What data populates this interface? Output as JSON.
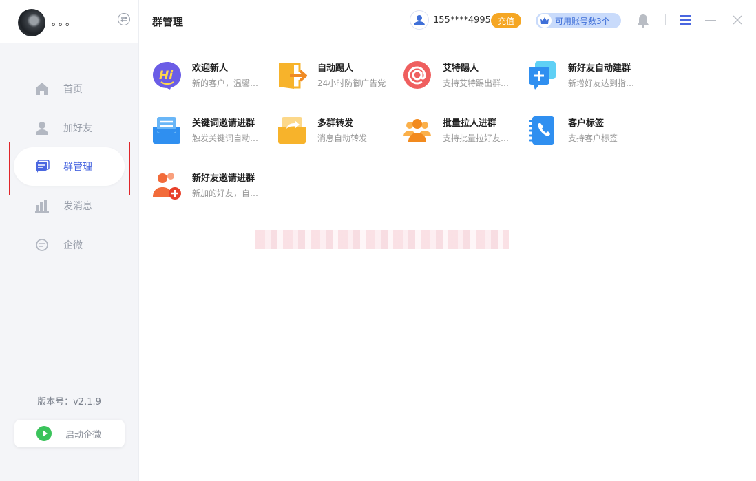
{
  "user": {
    "name": "。。。"
  },
  "nav": [
    {
      "label": "首页",
      "icon": "home-icon"
    },
    {
      "label": "加好友",
      "icon": "person-icon"
    },
    {
      "label": "群管理",
      "icon": "group-manage-icon",
      "active": true
    },
    {
      "label": "发消息",
      "icon": "chart-icon"
    },
    {
      "label": "企微",
      "icon": "chat-icon"
    }
  ],
  "version": "版本号：v2.1.9",
  "start_button": "启动企微",
  "header": {
    "title": "群管理",
    "phone": "155****4995",
    "recharge": "充值",
    "accounts": "可用账号数3个"
  },
  "features": [
    {
      "title": "欢迎新人",
      "desc": "新的客户，温馨…",
      "icon": "hi-icon"
    },
    {
      "title": "自动踢人",
      "desc": "24小时防御广告党",
      "icon": "exit-door-icon"
    },
    {
      "title": "艾特踢人",
      "desc": "支持艾特踢出群…",
      "icon": "at-sign-icon"
    },
    {
      "title": "新好友自动建群",
      "desc": "新增好友达到指…",
      "icon": "add-chat-icon"
    },
    {
      "title": "关键词邀请进群",
      "desc": "触发关键词自动…",
      "icon": "keyword-envelope-icon"
    },
    {
      "title": "多群转发",
      "desc": "消息自动转发",
      "icon": "forward-envelope-icon"
    },
    {
      "title": "批量拉人进群",
      "desc": "支持批量拉好友…",
      "icon": "group-people-icon"
    },
    {
      "title": "客户标签",
      "desc": "支持客户标签",
      "icon": "phone-book-icon"
    },
    {
      "title": "新好友邀请进群",
      "desc": "新加的好友，自…",
      "icon": "add-person-icon"
    }
  ],
  "colors": {
    "accent": "#4a67e0",
    "recharge": "#f5a623",
    "highlight_border": "#e0252a",
    "start_green": "#3ac35b"
  }
}
